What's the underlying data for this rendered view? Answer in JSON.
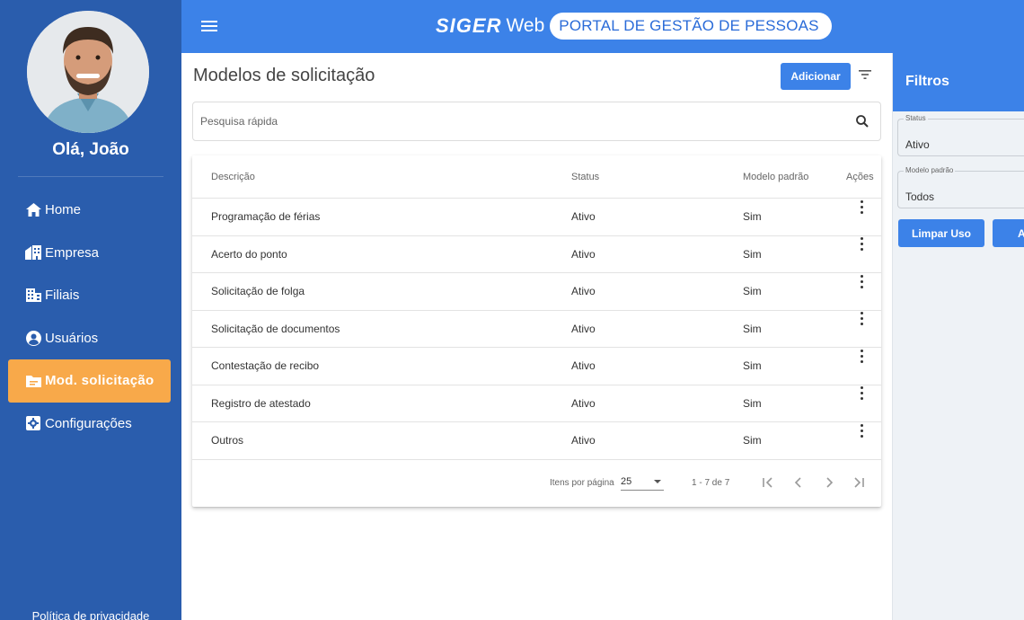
{
  "sidebar": {
    "greeting": "Olá, João",
    "items": [
      {
        "label": "Home",
        "icon": "home-icon"
      },
      {
        "label": "Empresa",
        "icon": "building-icon"
      },
      {
        "label": "Filiais",
        "icon": "branches-icon"
      },
      {
        "label": "Usuários",
        "icon": "user-circle-icon"
      },
      {
        "label": "Mod. solicitação",
        "icon": "folder-icon",
        "active": true
      },
      {
        "label": "Configurações",
        "icon": "settings-icon"
      }
    ],
    "privacy": "Política de privacidade"
  },
  "header": {
    "brand_main": "SIGER",
    "brand_sub": "Web",
    "portal": "PORTAL DE GESTÃO DE PESSOAS"
  },
  "main": {
    "title": "Modelos de solicitação",
    "add_label": "Adicionar",
    "search_placeholder": "Pesquisa rápida",
    "columns": {
      "desc": "Descrição",
      "status": "Status",
      "modelo": "Modelo padrão",
      "acoes": "Ações"
    },
    "rows": [
      {
        "desc": "Programação de férias",
        "status": "Ativo",
        "modelo": "Sim"
      },
      {
        "desc": "Acerto do ponto",
        "status": "Ativo",
        "modelo": "Sim"
      },
      {
        "desc": "Solicitação de folga",
        "status": "Ativo",
        "modelo": "Sim"
      },
      {
        "desc": "Solicitação de documentos",
        "status": "Ativo",
        "modelo": "Sim"
      },
      {
        "desc": "Contestação de recibo",
        "status": "Ativo",
        "modelo": "Sim"
      },
      {
        "desc": "Registro de atestado",
        "status": "Ativo",
        "modelo": "Sim"
      },
      {
        "desc": "Outros",
        "status": "Ativo",
        "modelo": "Sim"
      }
    ],
    "paginator": {
      "label": "Itens por página",
      "page_size": "25",
      "range": "1 - 7 de 7"
    }
  },
  "filters": {
    "title": "Filtros",
    "status_label": "Status",
    "status_value": "Ativo",
    "modelo_label": "Modelo padrão",
    "modelo_value": "Todos",
    "clear_label": "Limpar Uso",
    "apply_label": "A"
  },
  "colors": {
    "sidebar": "#2a5dad",
    "header": "#3c82e8",
    "active_nav": "#f8a94a",
    "filters_bg": "#eef2f6"
  }
}
